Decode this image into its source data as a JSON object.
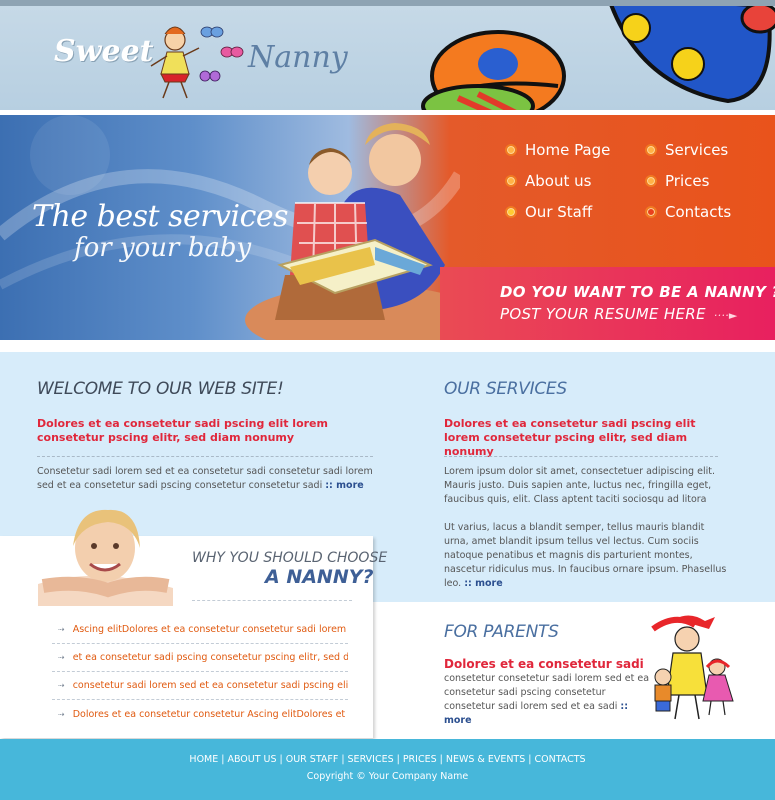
{
  "brand": {
    "sweet": "Sweet",
    "nanny": "Nanny"
  },
  "banner": {
    "slogan_line1": "The best services",
    "slogan_line2": "for your baby",
    "nav": [
      "Home Page",
      "About us",
      "Our Staff",
      "Services",
      "Prices",
      "Contacts"
    ],
    "resume_question": "DO YOU WANT TO BE A NANNY ?",
    "resume_action": "POST YOUR RESUME HERE"
  },
  "welcome": {
    "title": "WELCOME TO OUR WEB SITE!",
    "lead": "Dolores et ea consetetur sadi pscing elit lorem consetetur pscing elitr, sed diam nonumy",
    "text": "Consetetur sadi lorem sed  et ea consetetur sadi consetetur sadi lorem sed et ea consetetur sadi pscing  consetetur consetetur sadi",
    "more": ":: more"
  },
  "services": {
    "title": "OUR SERVICES",
    "lead": "Dolores et ea consetetur sadi pscing elit lorem consetetur pscing elitr, sed diam nonumy",
    "text1": "Lorem ipsum dolor sit amet, consectetuer adipiscing elit. Mauris justo. Duis sapien ante, luctus nec, fringilla eget, faucibus quis, elit. Class aptent taciti sociosqu ad litora",
    "text2": "Ut varius, lacus a blandit semper, tellus mauris blandit urna, amet blandit ipsum tellus vel lectus. Cum sociis natoque penatibus et magnis dis parturient montes, nascetur ridiculus mus. In faucibus ornare ipsum. Phasellus leo.",
    "more": ":: more"
  },
  "why": {
    "line1": "WHY YOU SHOULD CHOOSE",
    "line2": "A NANNY?",
    "items": [
      "Ascing elitDolores et ea consetetur consetetur sadi lorem sed",
      "et ea consetetur sadi pscing consetetur pscing elitr, sed diam",
      "consetetur sadi lorem sed  et ea consetetur sadi pscing elit",
      "Dolores et ea consetetur consetetur Ascing elitDolores et ea"
    ]
  },
  "parents": {
    "title": "FOR PARENTS",
    "lead": "Dolores et ea consetetur sadi",
    "text": "consetetur consetetur sadi lorem sed  et ea consetetur sadi pscing consetetur consetetur sadi lorem sed  et ea sadi",
    "more": ":: more"
  },
  "footer": {
    "links": [
      "HOME",
      "ABOUT US",
      "OUR STAFF",
      "SERVICES",
      "PRICES",
      "NEWS & EVENTS",
      "CONTACTS"
    ],
    "copyright": "Copyright © Your Company Name"
  },
  "colors": {
    "accent_red": "#e0273b",
    "nav_orange": "#e9531b",
    "footer_blue": "#47b7da",
    "content_bg": "#d7ecfa",
    "link_blue": "#2b4f8f"
  }
}
